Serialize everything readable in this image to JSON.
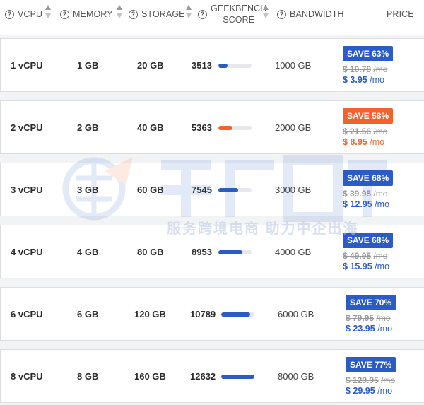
{
  "header": {
    "columns": [
      {
        "label": "VCPU"
      },
      {
        "label": "MEMORY"
      },
      {
        "label": "STORAGE"
      },
      {
        "label_line1": "GEEKBENCH",
        "label_line2": "SCORE"
      },
      {
        "label": "BANDWIDTH"
      },
      {
        "label": "PRICE"
      }
    ]
  },
  "plans": [
    {
      "vcpu": "1 vCPU",
      "memory": "1 GB",
      "storage": "20 GB",
      "score": "3513",
      "score_fraction": 0.28,
      "bandwidth": "1000 GB",
      "save": "SAVE 63%",
      "old_price": "$ 10.78",
      "old_per": "/mo",
      "new_price": "$ 3.95",
      "new_per": "/mo",
      "accent": "#2a5cc4"
    },
    {
      "vcpu": "2 vCPU",
      "memory": "2 GB",
      "storage": "40 GB",
      "score": "5363",
      "score_fraction": 0.42,
      "bandwidth": "2000 GB",
      "save": "SAVE 58%",
      "old_price": "$ 21.56",
      "old_per": "/mo",
      "new_price": "$ 8.95",
      "new_per": "/mo",
      "accent": "#f2622e"
    },
    {
      "vcpu": "3 vCPU",
      "memory": "3 GB",
      "storage": "60 GB",
      "score": "7545",
      "score_fraction": 0.6,
      "bandwidth": "3000 GB",
      "save": "SAVE 68%",
      "old_price": "$ 39.95",
      "old_per": "/mo",
      "new_price": "$ 12.95",
      "new_per": "/mo",
      "accent": "#2a5cc4"
    },
    {
      "vcpu": "4 vCPU",
      "memory": "4 GB",
      "storage": "80 GB",
      "score": "8953",
      "score_fraction": 0.72,
      "bandwidth": "4000 GB",
      "save": "SAVE 68%",
      "old_price": "$ 49.95",
      "old_per": "/mo",
      "new_price": "$ 15.95",
      "new_per": "/mo",
      "accent": "#2a5cc4"
    },
    {
      "vcpu": "6 vCPU",
      "memory": "6 GB",
      "storage": "120 GB",
      "score": "10789",
      "score_fraction": 0.88,
      "bandwidth": "6000 GB",
      "save": "SAVE 70%",
      "old_price": "$ 79.95",
      "old_per": "/mo",
      "new_price": "$ 23.95",
      "new_per": "/mo",
      "accent": "#2a5cc4"
    },
    {
      "vcpu": "8 vCPU",
      "memory": "8 GB",
      "storage": "160 GB",
      "score": "12632",
      "score_fraction": 1.0,
      "bandwidth": "8000 GB",
      "save": "SAVE 77%",
      "old_price": "$ 129.95",
      "old_per": "/mo",
      "new_price": "$ 29.95",
      "new_per": "/mo",
      "accent": "#2a5cc4"
    }
  ],
  "watermark": {
    "text": "服务跨境电商 助力中企出海"
  },
  "colors": {
    "accent_blue": "#2a5cc4",
    "accent_orange": "#f2622e",
    "muted": "#9a9a9a"
  }
}
